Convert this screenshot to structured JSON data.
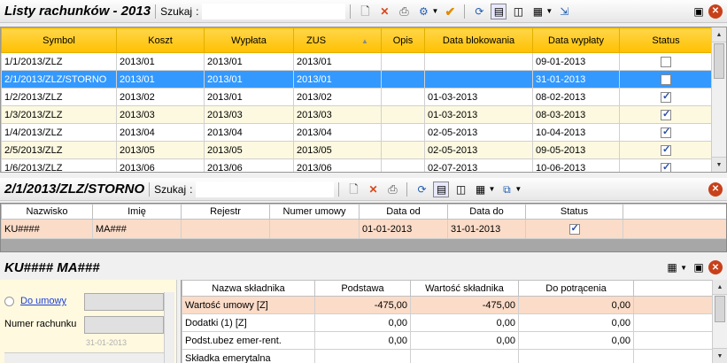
{
  "top": {
    "title": "Listy rachunków - 2013",
    "search_label": "Szukaj",
    "search_colon": ":",
    "search_value": "",
    "columns": [
      "Symbol",
      "Koszt",
      "Wypłata",
      "ZUS",
      "Opis",
      "Data blokowania",
      "Data wypłaty",
      "Status"
    ],
    "rows": [
      {
        "symbol": "1/1/2013/ZLZ",
        "koszt": "2013/01",
        "wyplata": "2013/01",
        "zus": "2013/01",
        "opis": "",
        "data_blok": "",
        "data_wyp": "09-01-2013",
        "status": false
      },
      {
        "symbol": "2/1/2013/ZLZ/STORNO",
        "koszt": "2013/01",
        "wyplata": "2013/01",
        "zus": "2013/01",
        "opis": "",
        "data_blok": "",
        "data_wyp": "31-01-2013",
        "status": false
      },
      {
        "symbol": "1/2/2013/ZLZ",
        "koszt": "2013/02",
        "wyplata": "2013/01",
        "zus": "2013/02",
        "opis": "",
        "data_blok": "01-03-2013",
        "data_wyp": "08-02-2013",
        "status": true
      },
      {
        "symbol": "1/3/2013/ZLZ",
        "koszt": "2013/03",
        "wyplata": "2013/03",
        "zus": "2013/03",
        "opis": "",
        "data_blok": "01-03-2013",
        "data_wyp": "08-03-2013",
        "status": true
      },
      {
        "symbol": "1/4/2013/ZLZ",
        "koszt": "2013/04",
        "wyplata": "2013/04",
        "zus": "2013/04",
        "opis": "",
        "data_blok": "02-05-2013",
        "data_wyp": "10-04-2013",
        "status": true
      },
      {
        "symbol": "2/5/2013/ZLZ",
        "koszt": "2013/05",
        "wyplata": "2013/05",
        "zus": "2013/05",
        "opis": "",
        "data_blok": "02-05-2013",
        "data_wyp": "09-05-2013",
        "status": true
      },
      {
        "symbol": "1/6/2013/ZLZ",
        "koszt": "2013/06",
        "wyplata": "2013/06",
        "zus": "2013/06",
        "opis": "",
        "data_blok": "02-07-2013",
        "data_wyp": "10-06-2013",
        "status": true
      }
    ]
  },
  "middle": {
    "title": "2/1/2013/ZLZ/STORNO",
    "search_label": "Szukaj",
    "search_colon": ":",
    "search_value": "",
    "columns": [
      "Nazwisko",
      "Imię",
      "Rejestr",
      "Numer umowy",
      "Data od",
      "Data do",
      "Status"
    ],
    "rows": [
      {
        "nazwisko": "KU####",
        "imie": "MA###",
        "rejestr": "",
        "numer": "",
        "data_od": "01-01-2013",
        "data_do": "31-01-2013",
        "status": true
      }
    ]
  },
  "bottom": {
    "title": "KU#### MA###",
    "left": {
      "do_umowy": "Do umowy",
      "numer_rachunku": "Numer rachunku",
      "date_hint": "31-01-2013"
    },
    "columns": [
      "Nazwa składnika",
      "Podstawa",
      "Wartość składnika",
      "Do potrącenia"
    ],
    "rows": [
      {
        "nazwa": "Wartość umowy [Z]",
        "podstawa": "-475,00",
        "wartosc": "-475,00",
        "potracenie": "0,00"
      },
      {
        "nazwa": "Dodatki (1) [Z]",
        "podstawa": "0,00",
        "wartosc": "0,00",
        "potracenie": "0,00"
      },
      {
        "nazwa": "Podst.ubez emer-rent.",
        "podstawa": "0,00",
        "wartosc": "0,00",
        "potracenie": "0,00"
      },
      {
        "nazwa": "Składka emerytalna",
        "podstawa": "",
        "wartosc": "",
        "potracenie": ""
      }
    ]
  },
  "icons": {
    "new": "new-document-icon",
    "delete": "delete-icon",
    "print": "print-icon",
    "settings": "gear-icon",
    "confirm": "checkmark-icon",
    "refresh": "refresh-icon",
    "filter": "filter-icon",
    "columns": "columns-icon",
    "grid": "grid-icon",
    "export": "export-icon",
    "calculator": "calculator-icon",
    "close": "close-icon"
  },
  "colors": {
    "header_yellow": "#ffc000",
    "selection_blue": "#3399ff",
    "row_alt": "#fdf9e0",
    "selected_peach": "#fbdcc8",
    "close_red": "#c8401a"
  }
}
